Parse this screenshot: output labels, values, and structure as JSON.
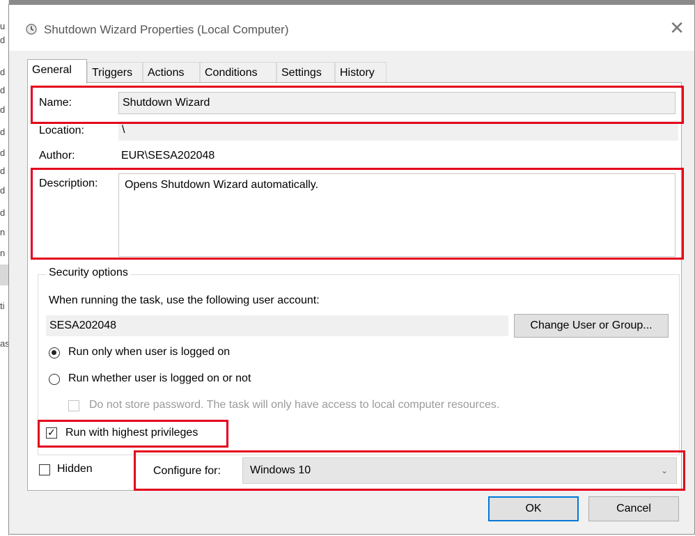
{
  "window": {
    "title": "Shutdown Wizard Properties (Local Computer)",
    "close_glyph": "✕"
  },
  "tabs": [
    {
      "label": "General",
      "active": true
    },
    {
      "label": "Triggers",
      "active": false
    },
    {
      "label": "Actions",
      "active": false
    },
    {
      "label": "Conditions",
      "active": false
    },
    {
      "label": "Settings",
      "active": false
    },
    {
      "label": "History",
      "active": false
    }
  ],
  "general": {
    "name_label": "Name:",
    "name_value": "Shutdown Wizard",
    "location_label": "Location:",
    "location_value": "\\",
    "author_label": "Author:",
    "author_value": "EUR\\SESA202048",
    "description_label": "Description:",
    "description_value": "Opens Shutdown Wizard automatically."
  },
  "security": {
    "group_title": "Security options",
    "account_prompt": "When running the task, use the following user account:",
    "account_value": "SESA202048",
    "change_button": "Change User or Group...",
    "radio_logged_on": "Run only when user is logged on",
    "radio_logged_on_selected": true,
    "radio_whether": "Run whether user is logged on or not",
    "radio_whether_selected": false,
    "no_store_password": "Do not store password.  The task will only have access to local computer resources.",
    "highest_privileges": "Run with highest privileges",
    "highest_privileges_checked": true
  },
  "bottom": {
    "hidden_label": "Hidden",
    "hidden_checked": false,
    "configure_label": "Configure for:",
    "configure_value": "Windows 10"
  },
  "buttons": {
    "ok": "OK",
    "cancel": "Cancel"
  },
  "behind_window_fragments": [
    "u",
    "d",
    "d",
    "d",
    "d",
    "d",
    "d",
    "d",
    "d",
    "d",
    "n",
    "n",
    "ti",
    "as"
  ],
  "colors": {
    "highlight": "#e3001b",
    "focus": "#0078d7"
  }
}
